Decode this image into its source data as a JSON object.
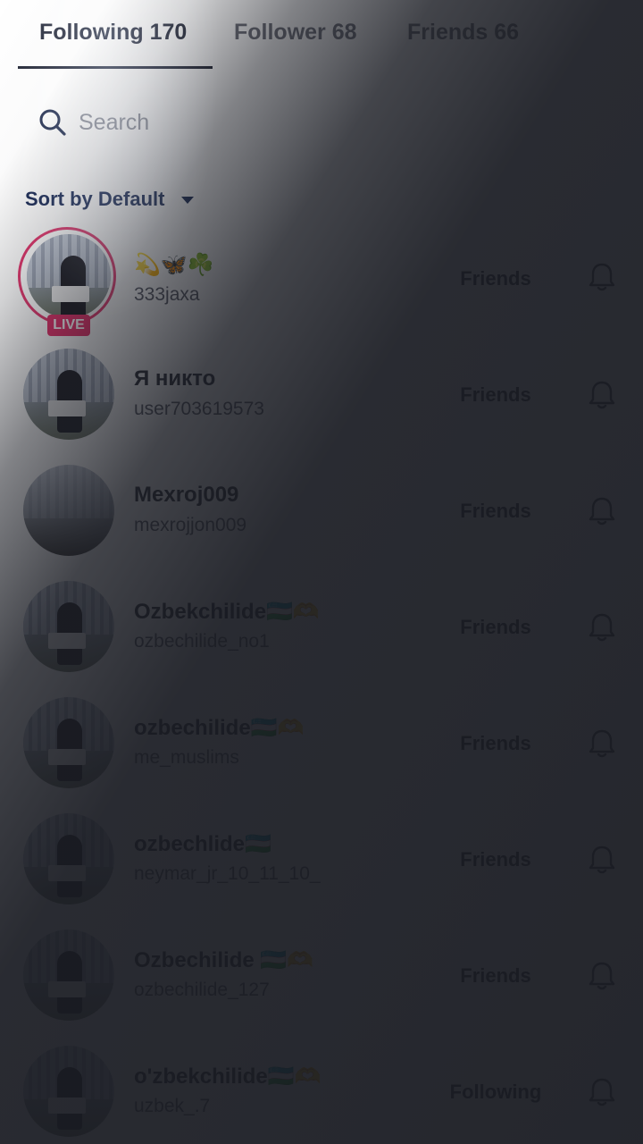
{
  "tabs": [
    {
      "label": "Following 170",
      "active": true
    },
    {
      "label": "Follower 68",
      "active": false
    },
    {
      "label": "Friends 66",
      "active": false
    }
  ],
  "search": {
    "placeholder": "Search",
    "value": ""
  },
  "sort": {
    "label": "Sort by Default"
  },
  "list": [
    {
      "name": "💫🦋☘️",
      "username": "333jaxa",
      "status": "Friends",
      "live": true,
      "live_label": "LIVE"
    },
    {
      "name": "Я никто",
      "username": "user703619573",
      "status": "Friends",
      "live": false
    },
    {
      "name": "Mexroj009",
      "username": "mexrojjon009",
      "status": "Friends",
      "live": false
    },
    {
      "name": "Ozbekchilide🇺🇿🫶",
      "username": "ozbechilide_no1",
      "status": "Friends",
      "live": false
    },
    {
      "name": "ozbechilide🇺🇿🫶",
      "username": "me_muslims",
      "status": "Friends",
      "live": false
    },
    {
      "name": "ozbechlide🇺🇿",
      "username": "neymar_jr_10_11_10_",
      "status": "Friends",
      "live": false
    },
    {
      "name": "Ozbechilide 🇺🇿🫶",
      "username": "ozbechilide_127",
      "status": "Friends",
      "live": false
    },
    {
      "name": "o'zbekchilide🇺🇿🫶",
      "username": "uzbek_.7",
      "status": "Following",
      "live": false
    }
  ],
  "icons": {
    "search": "search-icon",
    "sort": "caret-down-icon",
    "notification": "bell-icon"
  },
  "colors": {
    "live": "#e6306a",
    "text_primary": "#2a2c36",
    "text_secondary": "#585a65",
    "accent_sort": "#1a2a55"
  }
}
